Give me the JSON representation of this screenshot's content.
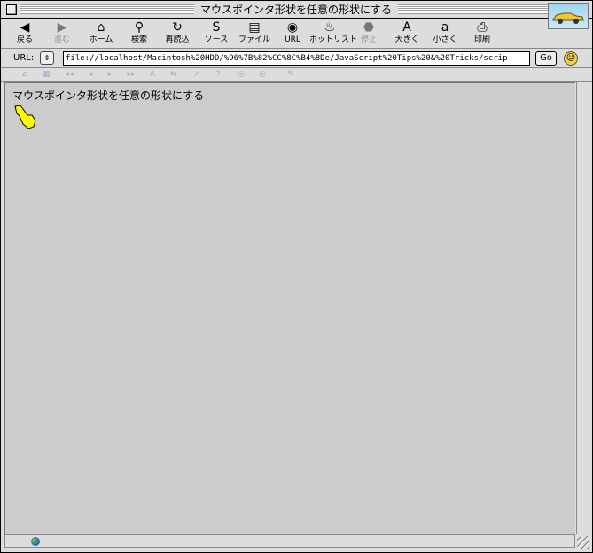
{
  "window": {
    "title": "マウスポインタ形状を任意の形状にする"
  },
  "toolbar": {
    "buttons": [
      {
        "label": "戻る",
        "icon": "back-arrow-icon",
        "glyph": "◀",
        "enabled": true
      },
      {
        "label": "進む",
        "icon": "forward-arrow-icon",
        "glyph": "▶",
        "enabled": false
      },
      {
        "label": "ホーム",
        "icon": "home-icon",
        "glyph": "⌂",
        "enabled": true
      },
      {
        "label": "検索",
        "icon": "search-icon",
        "glyph": "⚲",
        "enabled": true
      },
      {
        "label": "再読込",
        "icon": "reload-icon",
        "glyph": "↻",
        "enabled": true
      },
      {
        "label": "ソース",
        "icon": "source-icon",
        "glyph": "S",
        "enabled": true
      },
      {
        "label": "ファイル",
        "icon": "file-icon",
        "glyph": "▤",
        "enabled": true
      },
      {
        "label": "URL",
        "icon": "url-globe-icon",
        "glyph": "◉",
        "enabled": true
      },
      {
        "label": "ホットリスト",
        "icon": "hotlist-icon",
        "glyph": "♨",
        "enabled": true
      },
      {
        "label": "停止",
        "icon": "stop-icon",
        "glyph": "⬣",
        "enabled": false
      },
      {
        "label": "大きく",
        "icon": "bigger-text-icon",
        "glyph": "A",
        "enabled": true
      },
      {
        "label": "小さく",
        "icon": "smaller-text-icon",
        "glyph": "a",
        "enabled": true
      },
      {
        "label": "印刷",
        "icon": "print-icon",
        "glyph": "⎙",
        "enabled": true
      }
    ]
  },
  "urlbar": {
    "label": "URL:",
    "popup_glyph": "⇕",
    "value": "file://localhost/Macintosh%20HDD/%96%7B%82%CC%8C%B4%8De/JavaScript%20Tips%20&%20Tricks/scrip",
    "go_label": "Go",
    "smiley_glyph": "☺"
  },
  "navbar2": {
    "icons": [
      "⌂",
      "▦",
      "◂◂",
      "◂",
      "▸",
      "▸▸",
      "A",
      "⇆",
      "✓",
      "?",
      "◎",
      "◎",
      "✎"
    ]
  },
  "content": {
    "page_text": "マウスポインタ形状を任意の形状にする"
  },
  "colors": {
    "chrome": "#dddddd",
    "page_background": "#cccccc",
    "cursor_fill": "#ffff00"
  }
}
